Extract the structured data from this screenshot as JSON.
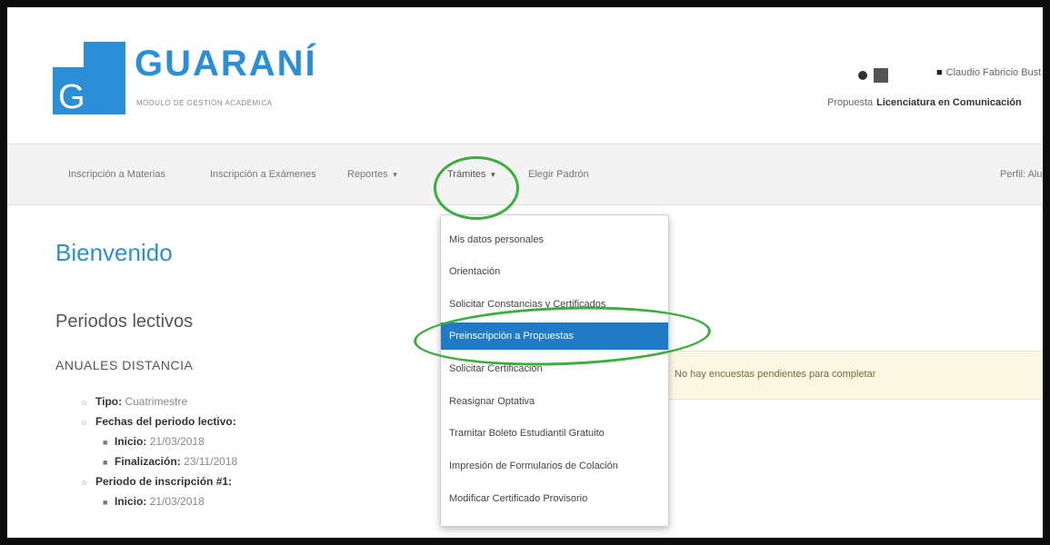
{
  "logo": {
    "letter": "G",
    "title": "GUARANÍ",
    "subtitle": "MÓDULO DE GESTIÓN ACADÉMICA"
  },
  "header": {
    "user_name": "Claudio Fabricio Bust",
    "propuesta_label": "Propuesta",
    "propuesta_value": "Licenciatura en Comunicación"
  },
  "nav": {
    "items": [
      {
        "label": "Inscripción a Materias"
      },
      {
        "label": "Inscripción a Exámenes"
      },
      {
        "label": "Reportes",
        "has_caret": true
      },
      {
        "label": "Trámites",
        "has_caret": true
      },
      {
        "label": "Elegir Padrón"
      }
    ],
    "perfil": "Perfil: Alum"
  },
  "main": {
    "welcome": "Bienvenido",
    "periodos_title": "Periodos lectivos",
    "group_title": "ANUALES DISTANCIA",
    "tipo_label": "Tipo:",
    "tipo_value": "Cuatrimestre",
    "fechas_label": "Fechas del periodo lectivo:",
    "inicio_label": "Inicio:",
    "inicio_value": "21/03/2018",
    "finalizacion_label": "Finalización:",
    "finalizacion_value": "23/11/2018",
    "periodo_inscripcion_label": "Periodo de inscripción #1:",
    "inicio2_label": "Inicio:",
    "inicio2_value": "21/03/2018"
  },
  "alert": {
    "text": "No hay encuestas pendientes para completar"
  },
  "dropdown": {
    "items": [
      {
        "label": "Mis datos personales"
      },
      {
        "label": "Orientación"
      },
      {
        "label": "Solicitar Constancias y Certificados"
      },
      {
        "label": "Preinscripción a Propuestas",
        "active": true
      },
      {
        "label": "Solicitar Certificación"
      },
      {
        "label": "Reasignar Optativa"
      },
      {
        "label": "Tramitar Boleto Estudiantil Gratuito"
      },
      {
        "label": "Impresión de Formularios de Colación"
      },
      {
        "label": "Modificar Certificado Provisorio"
      }
    ]
  },
  "colors": {
    "brand_blue": "#2a8fd6",
    "active_item": "#1f7bc7",
    "highlight_green": "#3cae3c",
    "alert_bg": "#fcf7e3"
  },
  "icons": [
    "envelope-icon",
    "user-icon",
    "caret-down-icon"
  ]
}
